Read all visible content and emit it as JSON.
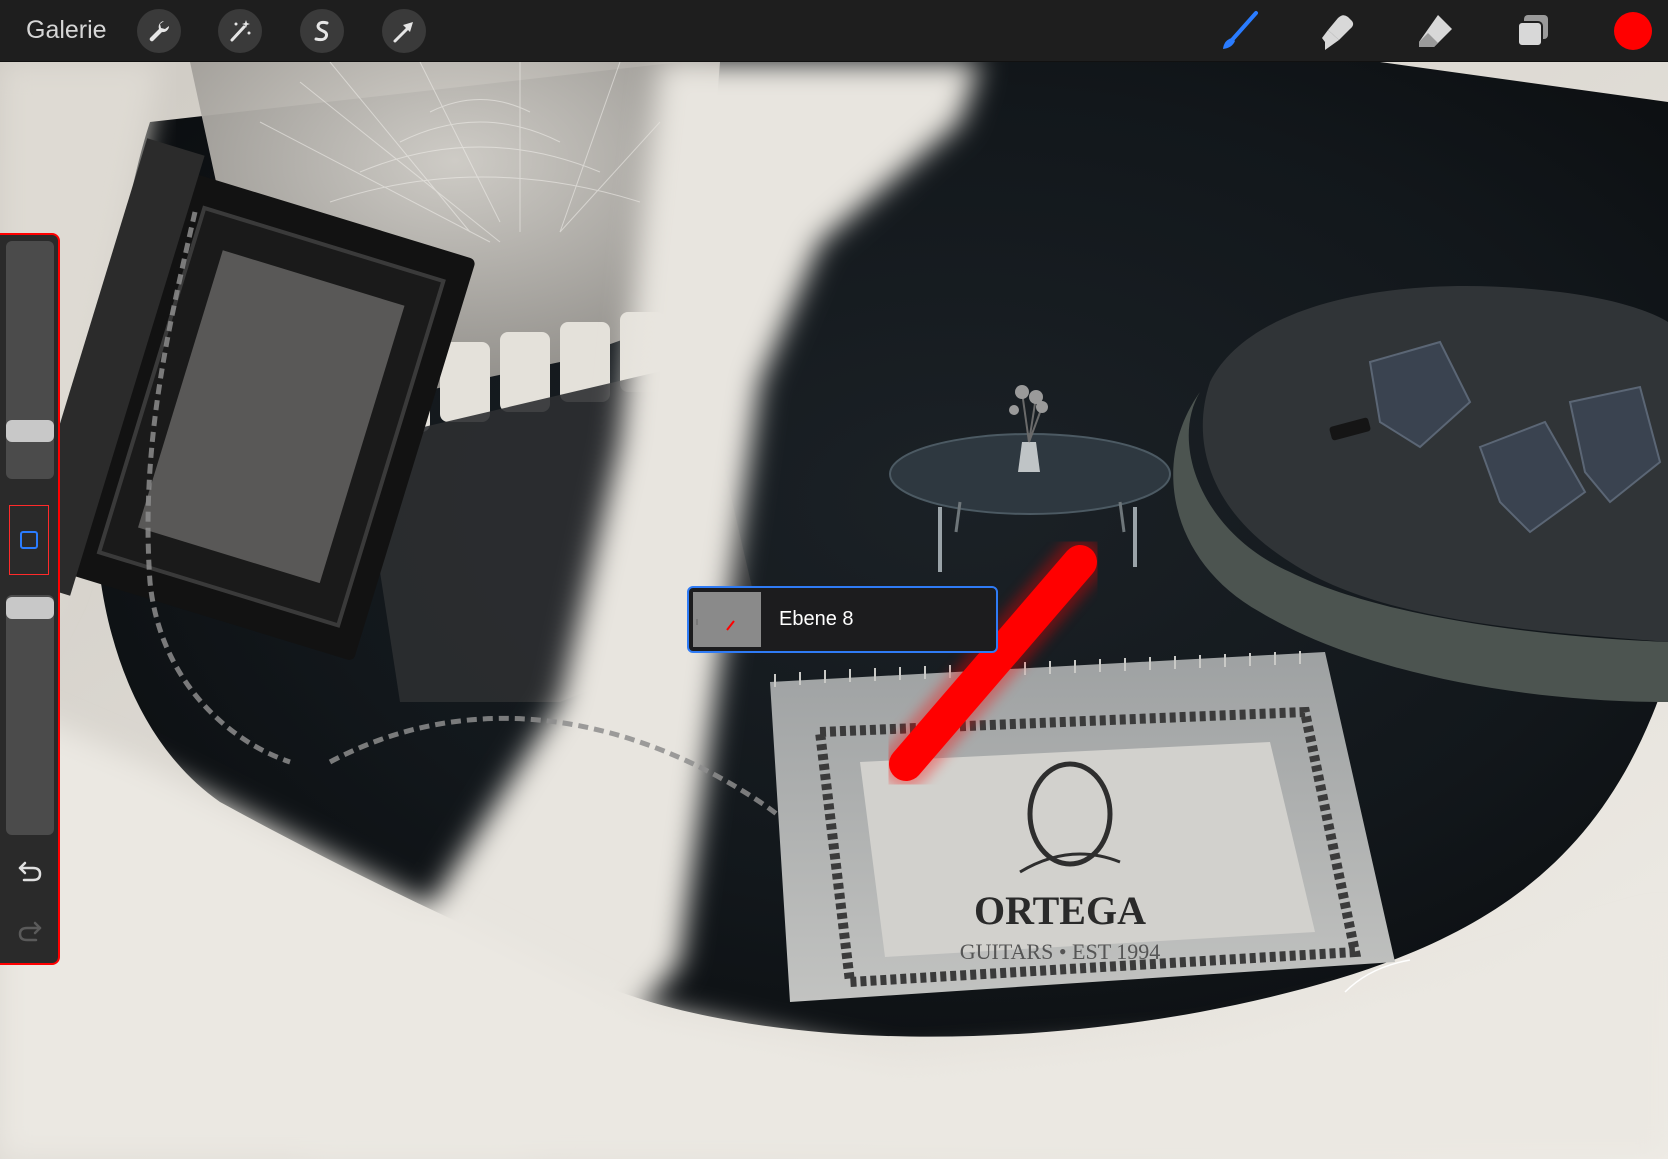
{
  "toolbar": {
    "gallery_label": "Galerie",
    "left_tools": [
      "wrench-icon",
      "magic-wand-icon",
      "selection-s-icon",
      "transform-arrow-icon"
    ],
    "right_tools": [
      "brush-icon",
      "smudge-icon",
      "eraser-icon",
      "layers-icon"
    ],
    "active_tool": "brush-icon",
    "active_tool_color": "#2a7cff",
    "current_color": "#ff0000"
  },
  "sidebar": {
    "size_slider_level": 0.22,
    "opacity_slider_level": 0.92,
    "modify_button": "square-icon",
    "undo": "undo-icon",
    "redo": "redo-icon"
  },
  "layer_popup": {
    "name": "Ebene 8",
    "accent": "#2f7bf5"
  },
  "canvas": {
    "stroke_color": "#ff0000",
    "artwork_text": [
      "ORTEGA",
      "GUITARS • EST 1994"
    ]
  }
}
